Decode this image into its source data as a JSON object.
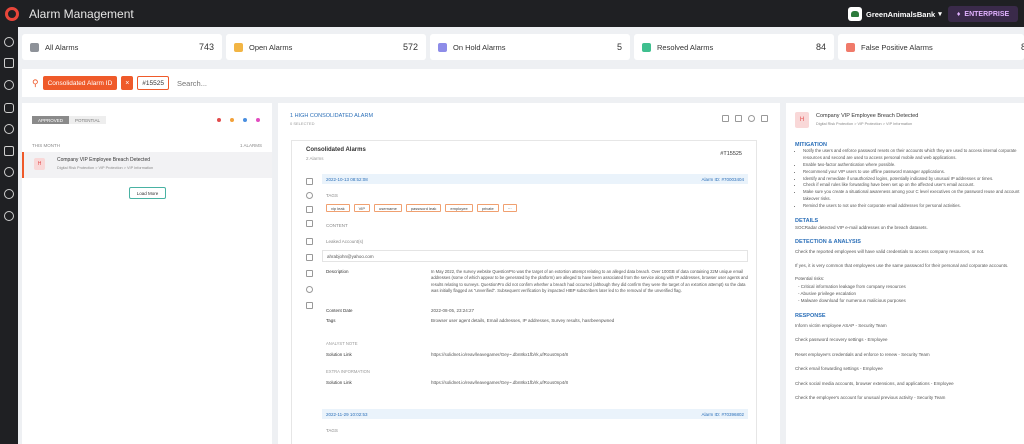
{
  "app": {
    "title": "Alarm Management",
    "tenant": "GreenAnimalsBank",
    "plan": "ENTERPRISE"
  },
  "stats": [
    {
      "label": "All Alarms",
      "value": "743",
      "color": "#8e9299"
    },
    {
      "label": "Open Alarms",
      "value": "572",
      "color": "#f2b544"
    },
    {
      "label": "On Hold Alarms",
      "value": "5",
      "color": "#8d8ce8"
    },
    {
      "label": "Resolved Alarms",
      "value": "84",
      "color": "#3fbf8f"
    },
    {
      "label": "False Positive Alarms",
      "value": "8",
      "color": "#f07a6a"
    }
  ],
  "search": {
    "filter_label": "Consolidated Alarm ID",
    "filter_remove": "×",
    "filter_value": "#15525",
    "placeholder": "Search..."
  },
  "left": {
    "seg": [
      "APPROVED",
      "POTENTIAL"
    ],
    "group_label": "THIS MONTH",
    "group_count": "1 ALARMS",
    "alarm": {
      "badge": "H",
      "title": "Company VIP Employee Breach Detected",
      "subtitle": "Digital Risk Protection > VIP Protection > VIP Information"
    },
    "load_more": "Load More"
  },
  "middle": {
    "header_title": "1 HIGH CONSOLIDATED ALARM",
    "header_sub": "0 SELECTED",
    "card_title": "Consolidated Alarms",
    "card_sub": "2 Alarms",
    "card_id": "#T15525",
    "alarm1_date": "2022-10-13 08:52:08",
    "alarm1_id": "Alarm ID: #70003404",
    "tags_label": "TAGS",
    "tags": [
      "vip leak",
      "VIP",
      "username",
      "password leak",
      "employee",
      "private",
      "···"
    ],
    "content_label": "CONTENT",
    "leaked_label": "Leaked Account(s)",
    "leaked_value": "ahrabjohn@yahoo.com",
    "description_label": "Description",
    "description": "In May 2022, the survey website QuestionPro was the target of an extortion attempt relating to an alleged data breach. Over 100GB of data containing 22M unique email addresses (some of which appear to be generated by the platform) are alleged to have been associated from the service along with IP addresses, browser user agents and results relating to surveys. QuestionPro did not confirm whether a breach had occurred (although they did confirm they were the target of an extortion attempt) so the data was initially flagged as \"unverified\". Subsequent verification by impacted HIBP subscribers later led to the removal of the unverified flag.",
    "content_date_label": "Content Date",
    "content_date": "2022-08-05, 23:24:27",
    "tags_row_label": "Tags",
    "tags_row_value": "Browser user agent details, Email addresses, IP addresses, Survey results, hasrbeenpwned",
    "analysis_label": "ANALYST NOTE",
    "solution_label": "Solution Link",
    "solution_link": "https://solidnet.io/reav/leavegamer/Gey~.dbn8kx1fb/rk,ufRous0np4/8",
    "extra_label": "EXTRA INFORMATION",
    "solution_label2": "Solution Link",
    "solution_link2": "https://solidnet.io/reav/leavegamer/Gey~.dbn8kx1fb/rk,ufRous0np4/8",
    "alarm2_date": "2022-11-29 10:02:53",
    "alarm2_id": "Alarm ID: #70396802",
    "tags_label2": "TAGS"
  },
  "right": {
    "badge": "H",
    "title": "Company VIP Employee Breach Detected",
    "subtitle": "Digital Risk Protection > VIP Protection > VIP Information",
    "mitigation_title": "MITIGATION",
    "mitigation": [
      "Notify the users and enforce password resets on their accounts which they are used to access internal corporate resources and second are used to access personal mobile and web applications.",
      "Enable two-factor authentication where possible.",
      "Recommend your VIP users to use offline password manager applications.",
      "Identify and remediate if unauthorized logins, potentially indicated by unusual IP addresses or times.",
      "Check if email rules like forwarding have been set up on the affected user's email account.",
      "Make sure you create a situational awareness among your C level executives on the password reuse and account takeover risks.",
      "Remind the users to not use their corporate email addresses for personal activities."
    ],
    "details_title": "DETAILS",
    "details": "SOCRadar detected VIP e-mail addresses on the breach datasets.",
    "detection_title": "DETECTION & ANALYSIS",
    "detection_1": "Check the reported employees will have valid credentials to access company resources, or not.",
    "detection_2": "If yes, it is very common that employees use the same password for their personal and corporate accounts.",
    "risks_label": "Potential risks:",
    "risks": [
      "Critical information leakage from company resources",
      "Abusive privilege escalation",
      "Malware download for numerous malicious purposes"
    ],
    "response_title": "RESPONSE",
    "response": [
      "Inform victim employee ASAP - Security Team",
      "Check password recovery settings - Employee",
      "Reset employee's credentials and enforce to renew - Security Team",
      "Check email forwarding settings - Employee",
      "Check social media accounts, browser extensions, and applications - Employee",
      "Check the employee's account for unusual previous activity - Security Team"
    ]
  }
}
